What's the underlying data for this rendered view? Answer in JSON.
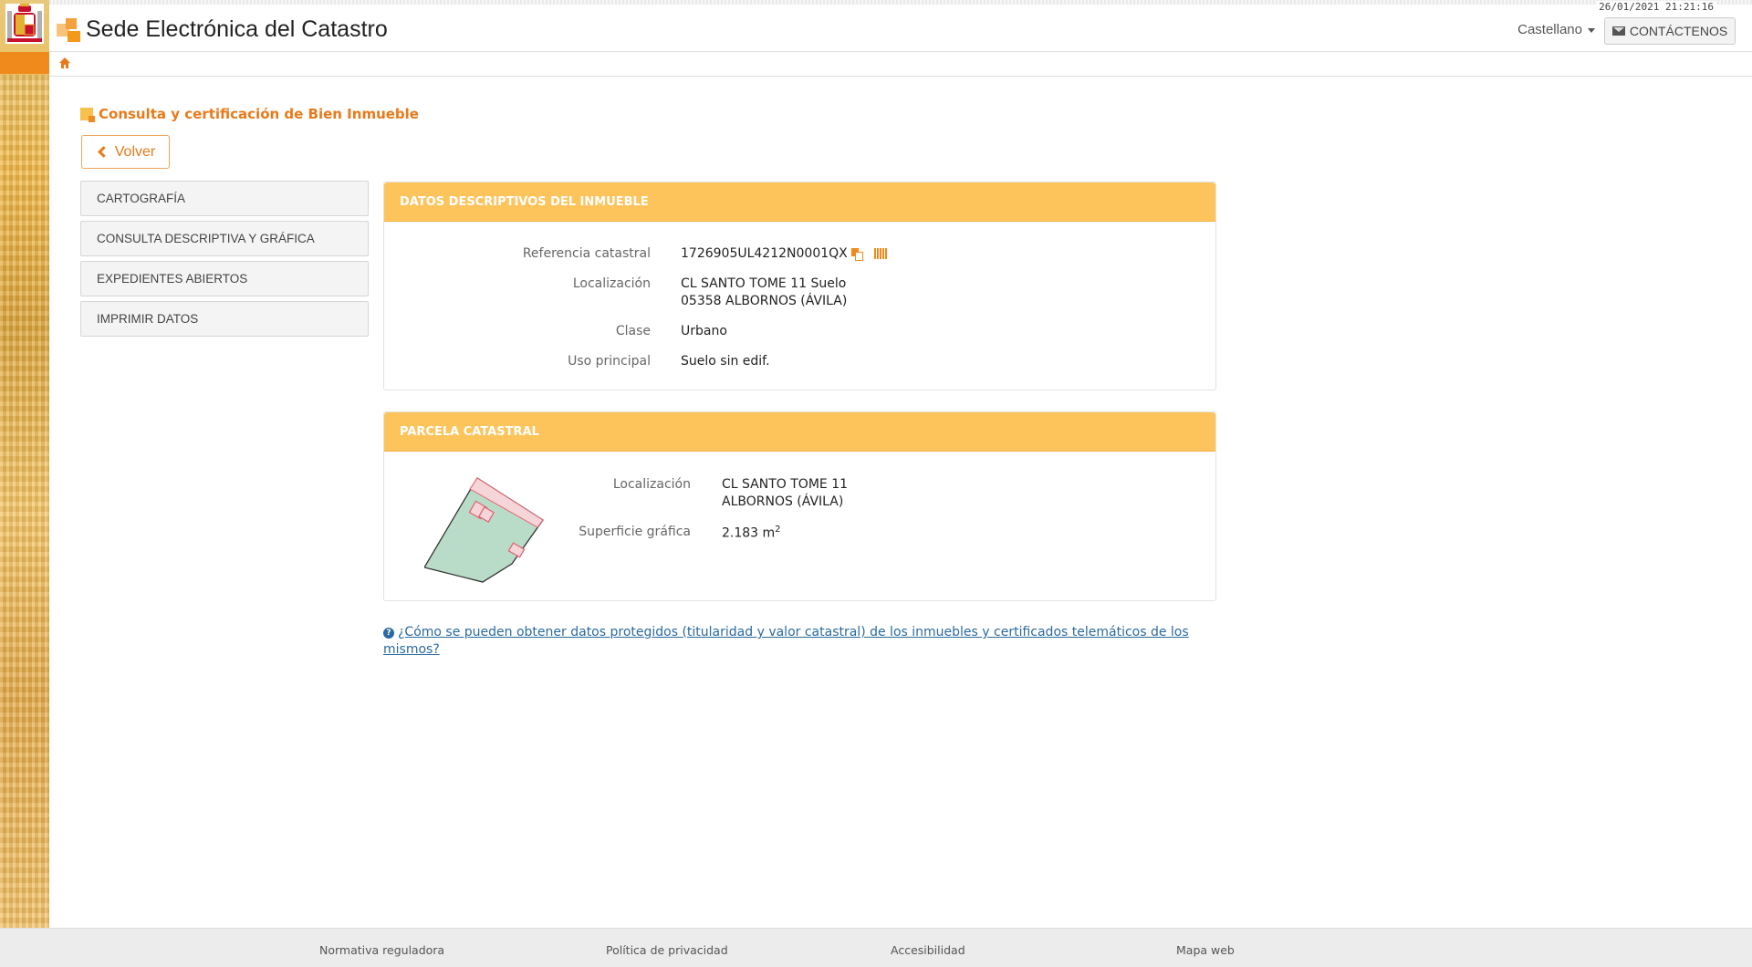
{
  "header": {
    "datetime": "26/01/2021  21:21:16",
    "site_title": "Sede Electrónica del Catastro",
    "language": "Castellano",
    "contact_label": "CONTÁCTENOS"
  },
  "page": {
    "title": "Consulta y certificación de Bien Inmueble",
    "back_label": "Volver"
  },
  "menu": {
    "items": [
      {
        "label": "CARTOGRAFÍA"
      },
      {
        "label": "CONSULTA DESCRIPTIVA Y GRÁFICA"
      },
      {
        "label": "EXPEDIENTES ABIERTOS"
      },
      {
        "label": "IMPRIMIR DATOS"
      }
    ]
  },
  "descriptivos": {
    "heading": "DATOS DESCRIPTIVOS DEL INMUEBLE",
    "ref_label": "Referencia catastral",
    "ref_value": "1726905UL4212N0001QX",
    "loc_label": "Localización",
    "loc_line1": "CL SANTO TOME 11 Suelo",
    "loc_line2": "05358 ALBORNOS (ÁVILA)",
    "clase_label": "Clase",
    "clase_value": "Urbano",
    "uso_label": "Uso principal",
    "uso_value": "Suelo sin edif."
  },
  "parcela": {
    "heading": "PARCELA CATASTRAL",
    "loc_label": "Localización",
    "loc_line1": "CL SANTO TOME 11",
    "loc_line2": "ALBORNOS (ÁVILA)",
    "sup_label": "Superficie gráfica",
    "sup_value": "2.183 m",
    "sup_unit_exp": "2"
  },
  "help": {
    "line1": "¿Cómo se pueden obtener datos protegidos (titularidad y valor catastral) de los inmuebles y certificados telemáticos de los",
    "line2": "mismos?"
  },
  "footer": {
    "links": [
      "Normativa reguladora",
      "Política de privacidad",
      "Accesibilidad",
      "Mapa web"
    ]
  },
  "colors": {
    "accent": "#e87a1a",
    "panel_header": "#fdc45c",
    "link": "#2a6aa0",
    "parcel_fill": "#b9dcc8",
    "parcel_border": "#e06070"
  }
}
